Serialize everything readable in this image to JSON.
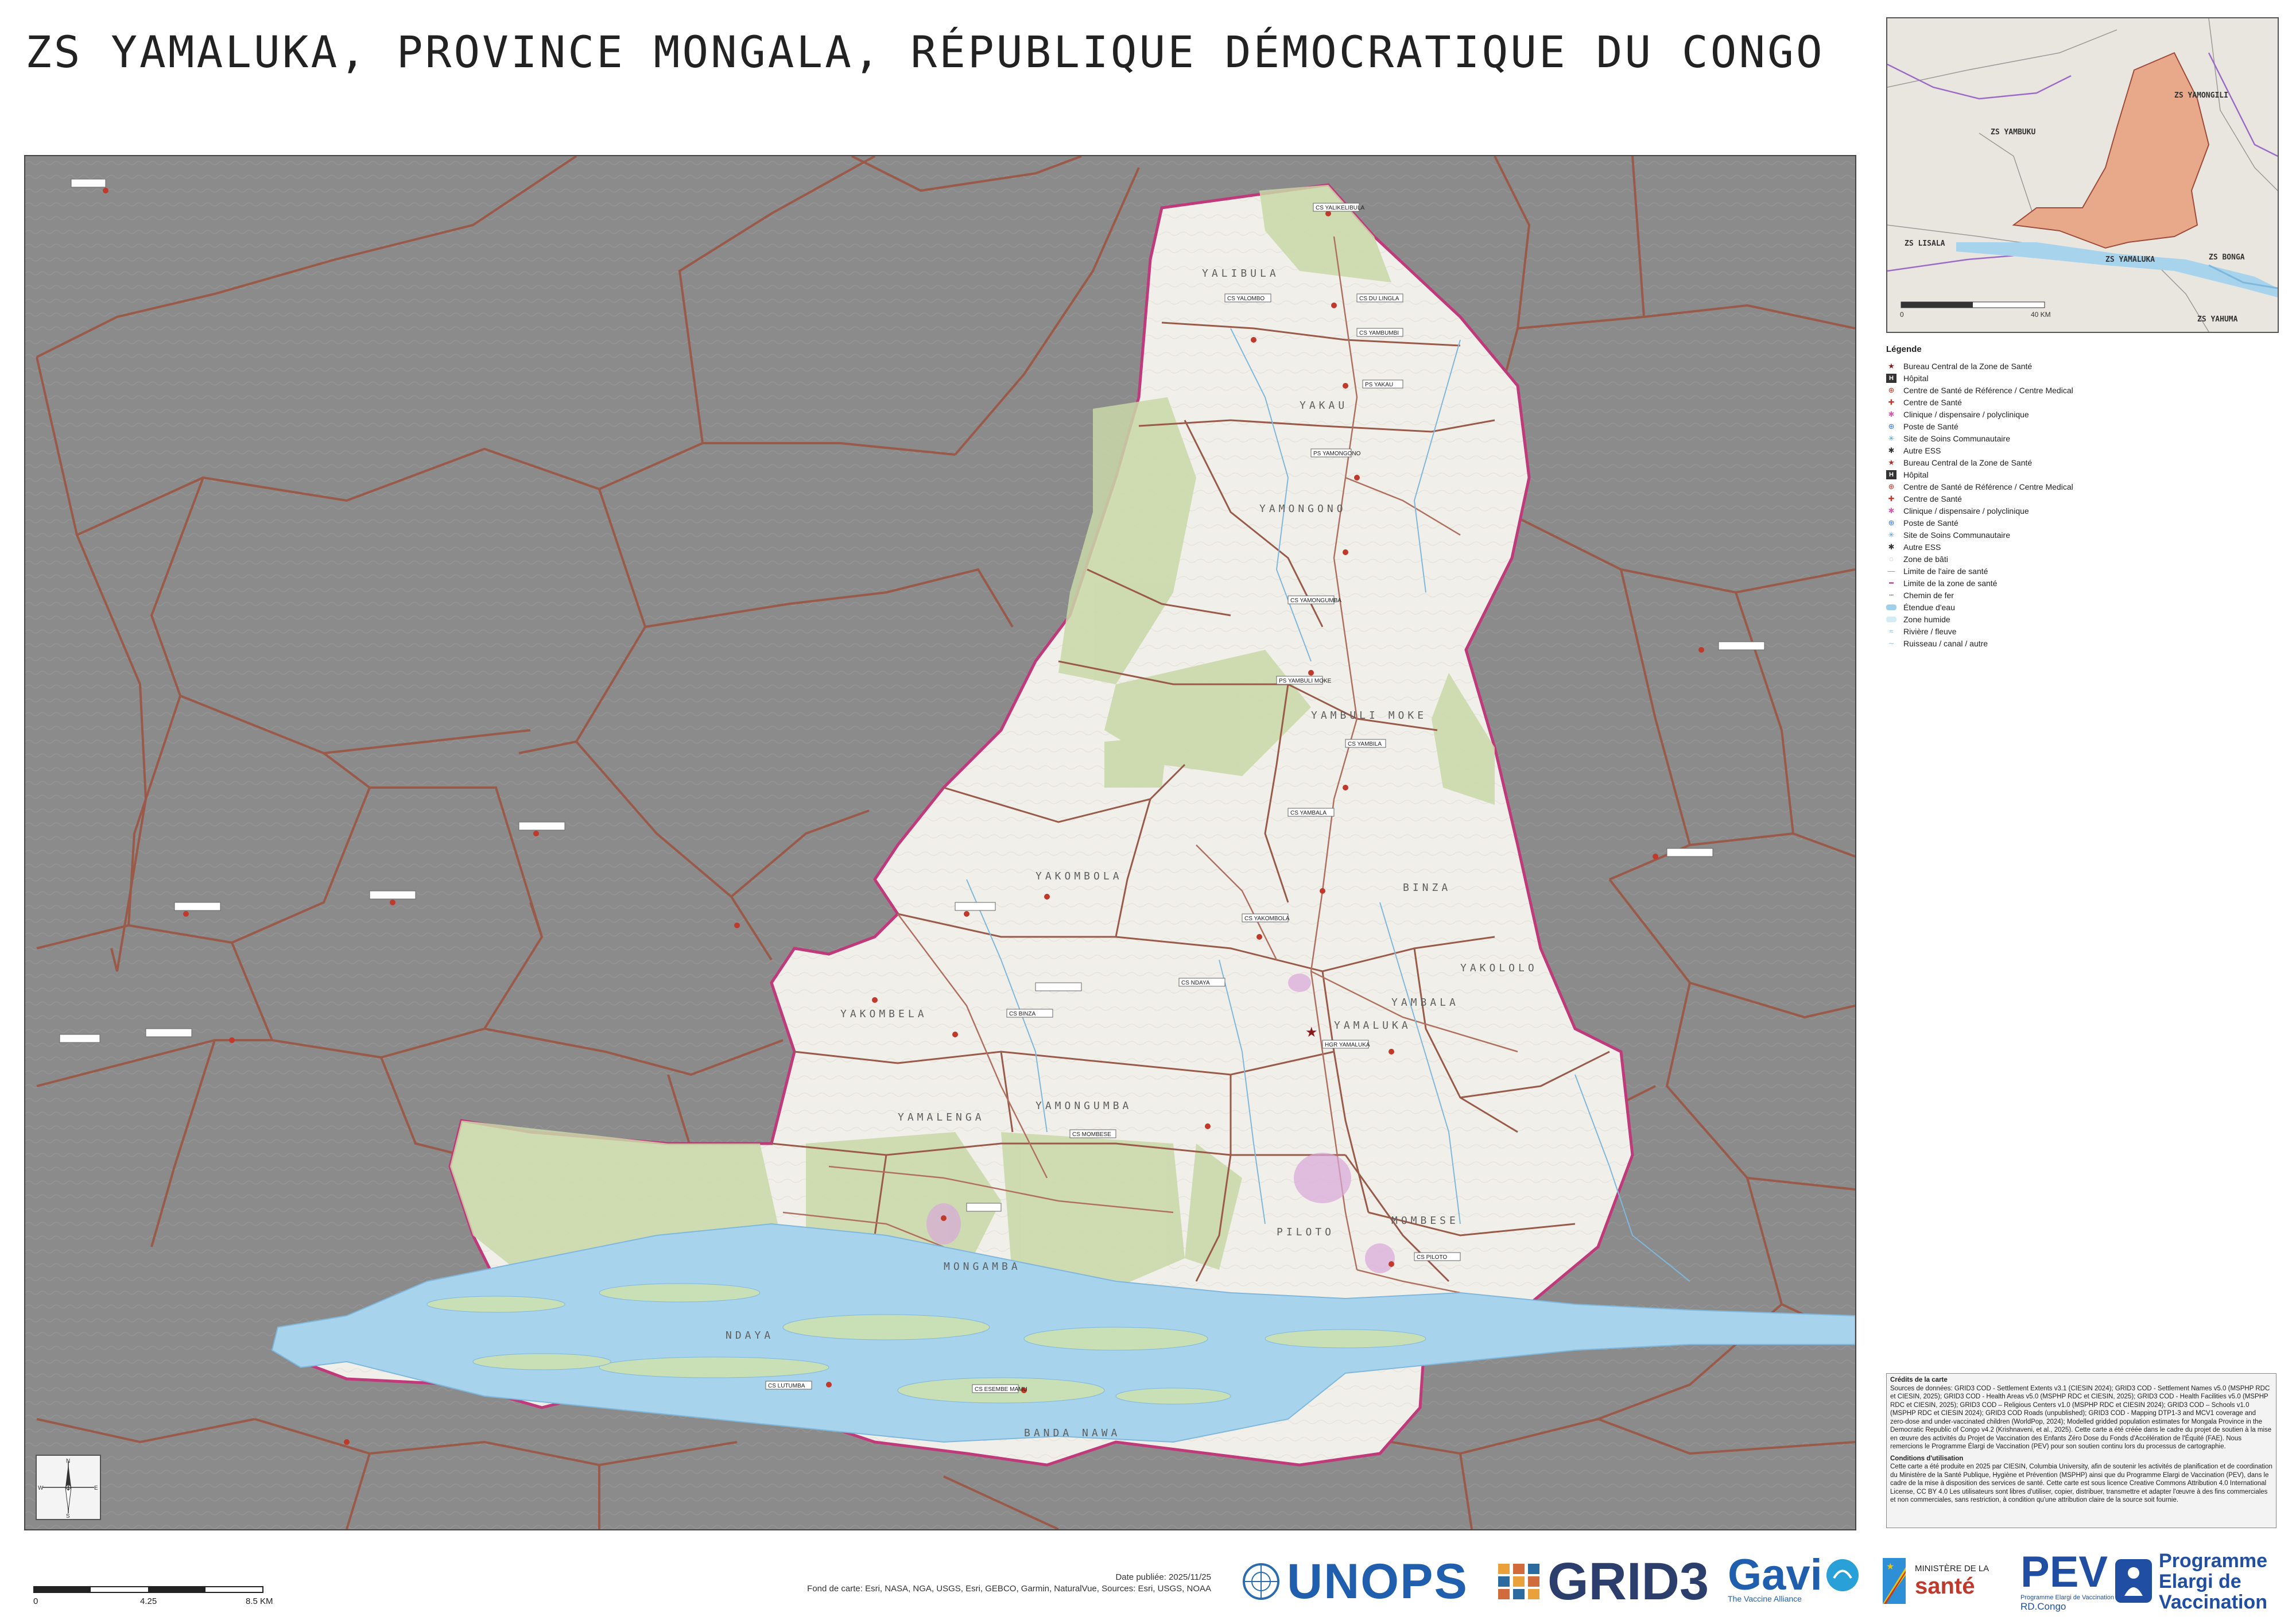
{
  "title": "ZS YAMALUKA, PROVINCE MONGALA, RÉPUBLIQUE DÉMOCRATIQUE DU CONGO",
  "inset": {
    "labels": [
      "ZS YAMBUKU",
      "ZS YAMONGILI",
      "ZS LISALA",
      "ZS YAMALUKA",
      "ZS BONGA",
      "ZS YAHUMA"
    ],
    "scale_zero": "0",
    "scale_end": "40 KM"
  },
  "legend": {
    "title": "Légende",
    "items": [
      {
        "label": "Bureau Central de la Zone de Santé",
        "icon": "star-icon",
        "color": "#8a1a1a"
      },
      {
        "label": "Hôpital",
        "icon": "h-square-icon",
        "color": "#333333"
      },
      {
        "label": "Centre de Santé de Référence / Centre Medical",
        "icon": "cross-circle-icon",
        "color": "#c0392b"
      },
      {
        "label": "Centre de Santé",
        "icon": "cross-dot-icon",
        "color": "#c0392b"
      },
      {
        "label": "Clinique / dispensaire / polyclinique",
        "icon": "asterisk-icon",
        "color": "#d35db0"
      },
      {
        "label": "Poste de Santé",
        "icon": "cross-circle-icon",
        "color": "#3a7bd5"
      },
      {
        "label": "Site de Soins Communautaire",
        "icon": "snowflake-icon",
        "color": "#3aa0d5"
      },
      {
        "label": "Autre ESS",
        "icon": "asterisk-icon",
        "color": "#333333"
      },
      {
        "label": "Bureau Central de la Zone de Santé",
        "icon": "star-icon",
        "color": "#b03030"
      },
      {
        "label": "Hôpital",
        "icon": "h-square-icon",
        "color": "#333333"
      },
      {
        "label": "Centre de Santé de Référence / Centre Medical",
        "icon": "cross-circle-icon",
        "color": "#c0392b"
      },
      {
        "label": "Centre de Santé",
        "icon": "cross-dot-icon",
        "color": "#c0392b"
      },
      {
        "label": "Clinique / dispensaire / polyclinique",
        "icon": "asterisk-icon",
        "color": "#d35db0"
      },
      {
        "label": "Poste de Santé",
        "icon": "cross-circle-icon",
        "color": "#3a7bd5"
      },
      {
        "label": "Site de Soins Communautaire",
        "icon": "snowflake-icon",
        "color": "#3aa0d5"
      },
      {
        "label": "Autre ESS",
        "icon": "asterisk-icon",
        "color": "#333333"
      },
      {
        "label": "Zone de bâti",
        "icon": "builtup-icon",
        "color": "#c873c8"
      },
      {
        "label": "Limite de l'aire de santé",
        "icon": "boundary-line-icon",
        "color": "#c8822c"
      },
      {
        "label": "Limite de la zone de santé",
        "icon": "zone-line-icon",
        "color": "#b0357a"
      },
      {
        "label": "Chemin de fer",
        "icon": "rail-line-icon",
        "color": "#888888"
      },
      {
        "label": "Étendue d'eau",
        "icon": "water-icon",
        "color": "#9fd0ea"
      },
      {
        "label": "Zone humide",
        "icon": "wetland-icon",
        "color": "#d4ecf4"
      },
      {
        "label": "Rivière / fleuve",
        "icon": "river-icon",
        "color": "#7fb8dc"
      },
      {
        "label": "Ruisseau / canal / autre",
        "icon": "stream-icon",
        "color": "#8fbfe0"
      }
    ]
  },
  "credits": {
    "heading1": "Crédits de la carte",
    "sources": "Sources de données: GRID3 COD - Settlement Extents v3.1 (CIESIN 2024); GRID3 COD - Settlement Names v5.0 (MSPHP RDC et CIESIN, 2025); GRID3 COD - Health Areas v5.0 (MSPHP RDC et CIESIN, 2025); GRID3 COD - Health Facilities v5.0 (MSPHP RDC et CIESIN, 2025); GRID3 COD – Religious Centers v1.0 (MSPHP RDC et CIESIN 2024); GRID3 COD – Schools v1.0 (MSPHP RDC et CIESIN 2024); GRID3 COD Roads (unpublished); GRID3 COD - Mapping DTP1-3 and MCV1 coverage and zero-dose and under-vaccinated children (WorldPop, 2024); Modelled gridded population estimates for Mongala Province in the Democratic Republic of Congo v4.2 (Krishnaveni, et al., 2025). Cette carte a été créée dans le cadre du projet de soutien à la mise en œuvre des activités du Projet de Vaccination des Enfants Zéro Dose du Fonds d'Accélération de l'Équité (FAE). Nous remercions le Programme Élargi de Vaccination (PEV) pour son soutien continu lors du processus de cartographie.",
    "heading2": "Conditions d'utilisation",
    "terms": "Cette carte a été produite en 2025 par CIESIN, Columbia University, afin de soutenir les activités de planification et de coordination du Ministère de la Santé Publique, Hygiène et Prévention (MSPHP) ainsi que du Programme Elargi de Vaccination (PEV), dans le cadre de la mise à disposition des services de santé. Cette carte est sous licence Creative Commons Attribution 4.0 International License, CC BY 4.0 Les utilisateurs sont libres d'utiliser, copier, distribuer, transmettre et adapter l'œuvre à des fins commerciales et non commerciales, sans restriction, à condition qu'une attribution claire de la source soit fournie."
  },
  "footer": {
    "date": "Date publiée: 2025/11/25",
    "basemap": "Fond de carte: Esri, NASA, NGA, USGS, Esri, GEBCO, Garmin, NaturalVue, Sources: Esri, USGS, NOAA",
    "scale_ticks": [
      "0",
      "4.25",
      "8.5 KM"
    ]
  },
  "logos": {
    "un_text": "UNOPS",
    "grid3_text": "GRID3",
    "gavi_text": "Gavi",
    "gavi_sub": "The Vaccine Alliance",
    "ministry_top": "MINISTÈRE DE LA",
    "ministry_main": "santé",
    "pev_text": "PEV",
    "pev_sub1": "Programme Elargi de Vaccination",
    "pev_sub2": "RD.Congo",
    "pev_right1": "Programme",
    "pev_right2": "Elargi de",
    "pev_right3": "Vaccination"
  },
  "map_labels": {
    "health_areas": [
      "YALIBULA",
      "YAKAU",
      "YAMONGONO",
      "YAMBULI MOKE",
      "YAMALUKA",
      "YAMBALA",
      "YAKOMBOLA",
      "YAMONGUMBA",
      "YAKOLOLO",
      "BINZA",
      "PILOTO",
      "MOMBESE",
      "MONGAMBA",
      "NDAYA",
      "BANDA NAWA",
      "YAKOMBELA",
      "YAMALENGA"
    ],
    "facilities": [
      "CS YALIKELIBULA",
      "CS YALOMBO",
      "CS DU LINGLA",
      "CS YAMBUMBI",
      "PS YAKAU",
      "PS YAMONGONO",
      "CS YAMONGUMBA",
      "PS YAMBULI MOKE",
      "CS YAMBILA",
      "CS YAMBALA",
      "CS YAKOMBOLA",
      "HGR YAMALUKA",
      "CS BINZA",
      "CS PILOTO",
      "CS MOMBESE",
      "CS ESEMBE MAMU",
      "CS LUTUMBA",
      "CS NDAYA"
    ]
  },
  "compass": {
    "n": "N",
    "s": "S",
    "e": "E",
    "w": "W"
  }
}
